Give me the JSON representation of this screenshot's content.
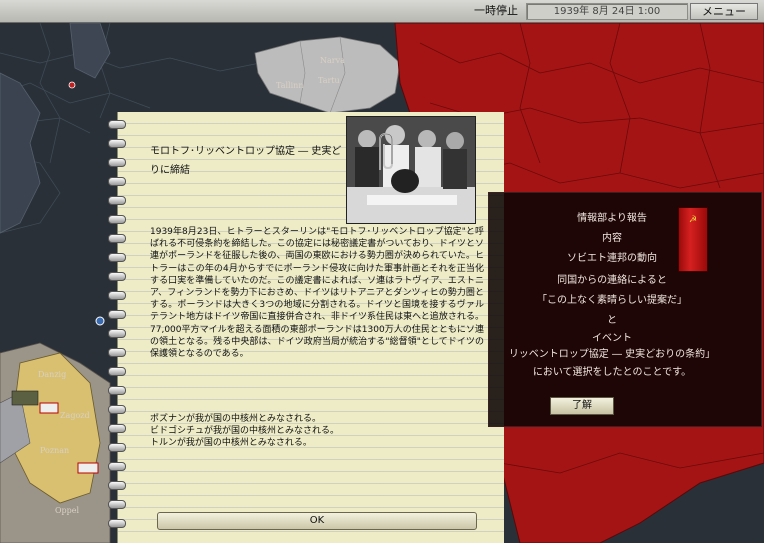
{
  "toolbar": {
    "pause_label": "一時停止",
    "date_text": "1939年 8月 24日 1:00",
    "menu_label": "メニュー"
  },
  "map": {
    "regions": [
      "Narva",
      "Tartu",
      "Tallinn",
      "Danzig",
      "Zagozd",
      "Poznan",
      "Oppel"
    ]
  },
  "event": {
    "title_line1": "モロトフ･リッベントロップ協定 ― 史実ど",
    "title_line2": "りに締結",
    "body": "1939年8月23日、ヒトラーとスターリンは\"モロトフ･リッベントロップ協定\"と呼ばれる不可侵条約を締結した。この協定には秘密議定書がついており、ドイツとソ連がポーランドを征服した後の、両国の東欧における勢力圏が決められていた。ヒトラーはこの年の4月からすでにポーランド侵攻に向けた軍事計画とそれを正当化する口実を準備していたのだ。この議定書によれば、ソ連はラトヴィア、エストニア、フィンランドを勢力下におさめ、ドイツはリトアニアとダンツィヒの勢力圏とする。ポーランドは大きく3つの地域に分割される。ドイツと国境を接するヴァルテラント地方はドイツ帝国に直接併合され、非ドイツ系住民は東へと追放される。77,000平方マイルを超える面積の東部ポーランドは1300万人の住民とともにソ連の領土となる。残る中央部は、ドイツ政府当局が統治する\"総督領\"としてドイツの保護領となるのである。",
    "effects": [
      "ポズナンが我が国の中核州とみなされる。",
      "ビドゴシチュが我が国の中核州とみなされる。",
      "トルンが我が国の中核州とみなされる。"
    ],
    "ok_label": "OK"
  },
  "report": {
    "title": "情報部より報告",
    "content_label": "内容",
    "country": "ソビエト連邦の動向",
    "line1": "同国からの連絡によると",
    "quote": "「この上なく素晴らしい提案だ」",
    "connector": "と",
    "event_label": "イベント",
    "event_name": "リッベントロップ協定 ― 史実どおりの条約」",
    "line_end": "において選択をしたとのことです。",
    "ack_label": "了解"
  },
  "colors": {
    "soviet_red": "#a51414",
    "paper": "#eeecc6",
    "sea": "#2a3038"
  }
}
